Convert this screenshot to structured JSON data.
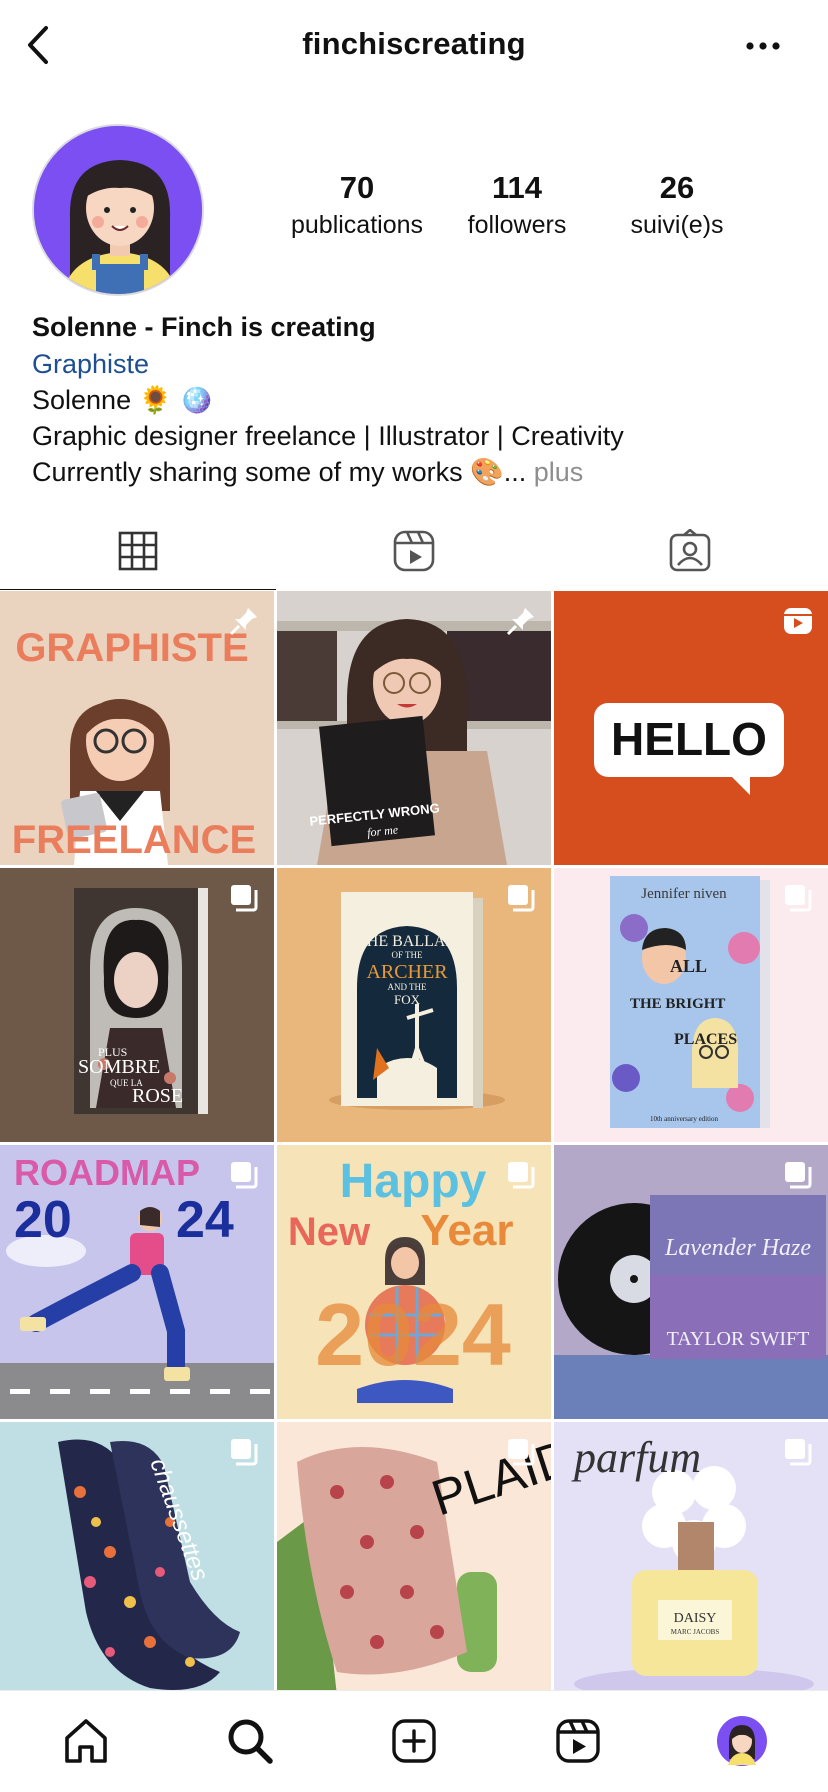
{
  "header": {
    "username": "finchiscreating"
  },
  "profile": {
    "stats": [
      {
        "value": "70",
        "label": "publications"
      },
      {
        "value": "114",
        "label": "followers"
      },
      {
        "value": "26",
        "label": "suivi(e)s"
      }
    ],
    "display_name": "Solenne - Finch is creating",
    "category": "Graphiste",
    "bio_line1": "Solenne 🌻 🪩",
    "bio_line2": "Graphic designer freelance | Illustrator | Creativity",
    "bio_line3": "Currently sharing some of my works 🎨...",
    "more_label": "plus"
  },
  "tabs": [
    {
      "icon": "grid-icon"
    },
    {
      "icon": "reels-icon"
    },
    {
      "icon": "tagged-icon"
    }
  ],
  "posts": [
    {
      "lines": [
        "GRAPHISTE",
        "FREELANCE"
      ],
      "badge": "pin-icon"
    },
    {
      "lines": [
        "PERFECTLY WRONG",
        "for me"
      ],
      "badge": "pin-icon"
    },
    {
      "lines": [
        "HELLO"
      ],
      "badge": "reel-icon"
    },
    {
      "lines": [
        "PLUS",
        "SOMBRE",
        "QUE LA",
        "ROSE"
      ],
      "badge": "carousel-icon"
    },
    {
      "lines": [
        "THE BALLAD",
        "OF THE",
        "ARCHER",
        "AND THE",
        "FOX"
      ],
      "badge": "carousel-icon"
    },
    {
      "lines": [
        "Jennifer niven",
        "ALL",
        "THE BRIGHT",
        "PLACES",
        "10th anniversary edition"
      ],
      "badge": "carousel-icon"
    },
    {
      "lines": [
        "ROADMAP",
        "20",
        "24"
      ],
      "badge": "carousel-icon"
    },
    {
      "lines": [
        "Happy",
        "New",
        "Year",
        "2024"
      ],
      "badge": "carousel-icon"
    },
    {
      "lines": [
        "Lavender Haze",
        "TAYLOR SWIFT"
      ],
      "badge": "carousel-icon"
    },
    {
      "lines": [
        "chaussettes"
      ],
      "badge": "carousel-icon"
    },
    {
      "lines": [
        "PLAID"
      ],
      "badge": "carousel-icon"
    },
    {
      "lines": [
        "parfum",
        "DAISY",
        "MARC JACOBS"
      ],
      "badge": "carousel-icon"
    }
  ],
  "nav": [
    {
      "icon": "home-icon"
    },
    {
      "icon": "search-icon"
    },
    {
      "icon": "create-icon"
    },
    {
      "icon": "reels-icon"
    },
    {
      "icon": "profile-avatar-icon"
    }
  ]
}
